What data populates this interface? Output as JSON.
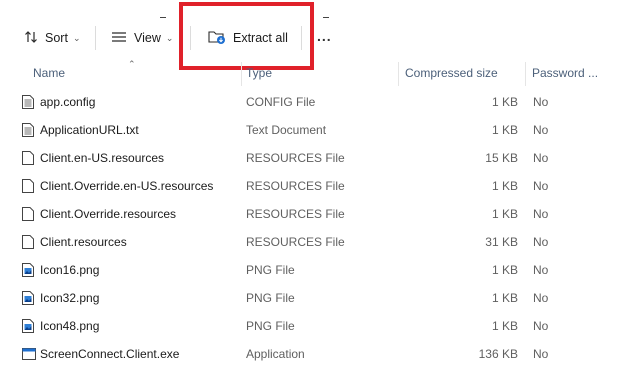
{
  "toolbar": {
    "sort_label": "Sort",
    "view_label": "View",
    "extract_label": "Extract all",
    "more_label": "..."
  },
  "columns": {
    "name": "Name",
    "type": "Type",
    "compressed_size": "Compressed size",
    "password": "Password ..."
  },
  "files": [
    {
      "name": "app.config",
      "type": "CONFIG File",
      "size": "1 KB",
      "password": "No",
      "icon": "config-file-icon"
    },
    {
      "name": "ApplicationURL.txt",
      "type": "Text Document",
      "size": "1 KB",
      "password": "No",
      "icon": "text-file-icon"
    },
    {
      "name": "Client.en-US.resources",
      "type": "RESOURCES File",
      "size": "15 KB",
      "password": "No",
      "icon": "blank-file-icon"
    },
    {
      "name": "Client.Override.en-US.resources",
      "type": "RESOURCES File",
      "size": "1 KB",
      "password": "No",
      "icon": "blank-file-icon"
    },
    {
      "name": "Client.Override.resources",
      "type": "RESOURCES File",
      "size": "1 KB",
      "password": "No",
      "icon": "blank-file-icon"
    },
    {
      "name": "Client.resources",
      "type": "RESOURCES File",
      "size": "31 KB",
      "password": "No",
      "icon": "blank-file-icon"
    },
    {
      "name": "Icon16.png",
      "type": "PNG File",
      "size": "1 KB",
      "password": "No",
      "icon": "image-file-icon"
    },
    {
      "name": "Icon32.png",
      "type": "PNG File",
      "size": "1 KB",
      "password": "No",
      "icon": "image-file-icon"
    },
    {
      "name": "Icon48.png",
      "type": "PNG File",
      "size": "1 KB",
      "password": "No",
      "icon": "image-file-icon"
    },
    {
      "name": "ScreenConnect.Client.exe",
      "type": "Application",
      "size": "136 KB",
      "password": "No",
      "icon": "application-icon"
    }
  ],
  "colors": {
    "highlight": "#e0212a",
    "header_text": "#4c607a",
    "accent": "#1e6fd0"
  }
}
